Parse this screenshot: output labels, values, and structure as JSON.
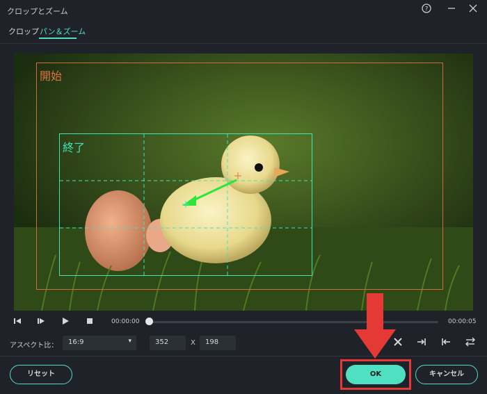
{
  "window": {
    "title": "クロップとズーム",
    "help_icon": "help-circle-icon",
    "minimize_icon": "minimize-icon",
    "close_icon": "close-icon"
  },
  "tabs": [
    {
      "label": "クロップ",
      "active": false
    },
    {
      "label": "パン＆ズーム",
      "active": true
    }
  ],
  "preview": {
    "start_label": "開始",
    "end_label": "終了",
    "start_color": "#d9673a",
    "end_color": "#3fe6b8"
  },
  "playback": {
    "current_time": "00:00:00",
    "end_time": "00:00:05",
    "progress": 0
  },
  "aspect": {
    "label": "アスペクト比：",
    "value": "16:9",
    "width": "352",
    "x_label": "X",
    "height": "198"
  },
  "buttons": {
    "reset": "リセット",
    "ok": "OK",
    "cancel": "キャンセル"
  },
  "colors": {
    "accent": "#4fe0c1",
    "background": "#1f2329",
    "annotation": "#e53935"
  }
}
